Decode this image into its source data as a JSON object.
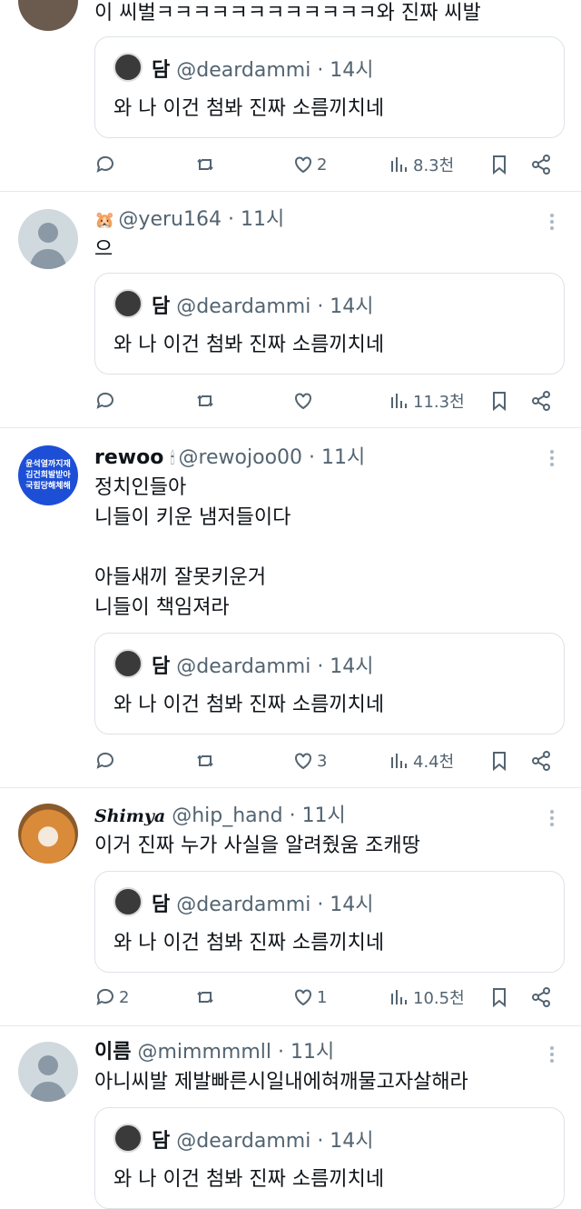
{
  "quoted": {
    "name": "담",
    "handle": "@deardammi",
    "time": "· 14시",
    "text": "와 나 이건 첨봐 진짜 소름끼치네"
  },
  "tweets": [
    {
      "text": "이 씨벌ㅋㅋㅋㅋㅋㅋㅋㅋㅋㅋㅋㅋ와 진짜 씨발",
      "replies": "",
      "retweets": "",
      "likes": "2",
      "views": "8.3천"
    },
    {
      "name": "",
      "emoji": "🐹",
      "handle": "@yeru164",
      "time": "· 11시",
      "text": "으",
      "replies": "",
      "retweets": "",
      "likes": "",
      "views": "11.3천"
    },
    {
      "name": "rewoo",
      "emoji": "🕯",
      "handle": "@rewojoo00",
      "time": "· 11시",
      "text": "정치인들아\n니들이 키운 냄저들이다\n\n아들새끼 잘못키운거\n니들이 책임져라",
      "avatar_text": "윤석열까지재\n김건희발받아\n국힘당해체해",
      "replies": "",
      "retweets": "",
      "likes": "3",
      "views": "4.4천"
    },
    {
      "name": "Shimya",
      "emoji": "",
      "handle": "@hip_hand",
      "time": "· 11시",
      "text": "이거 진짜 누가 사실을 알려줬움 조캐땅",
      "replies": "2",
      "retweets": "",
      "likes": "1",
      "views": "10.5천"
    },
    {
      "name": "이름",
      "emoji": "",
      "handle": "@mimmmmll",
      "time": "· 11시",
      "text": "아니씨발 제발빠른시일내에혀깨물고자살해라"
    }
  ]
}
